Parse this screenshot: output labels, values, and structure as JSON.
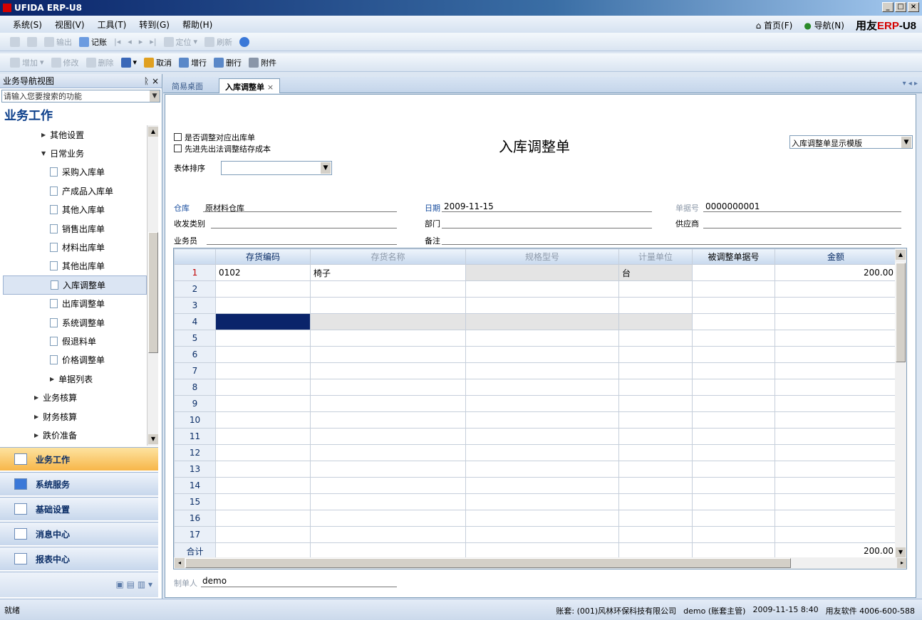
{
  "window": {
    "title": "UFIDA ERP-U8"
  },
  "menu": {
    "items": [
      "系统(S)",
      "视图(V)",
      "工具(T)",
      "转到(G)",
      "帮助(H)"
    ],
    "home": "首页(F)",
    "navigate": "导航(N)",
    "brand_prefix": "用友",
    "brand_erp": "ERP",
    "brand_suffix": "-U8"
  },
  "toolbar1": [
    "输出",
    "记账",
    "定位",
    "刷新"
  ],
  "toolbar2": [
    "增加",
    "修改",
    "删除",
    "取消",
    "增行",
    "删行",
    "附件"
  ],
  "nav": {
    "header": "业务导航视图",
    "search_placeholder": "请输入您要搜索的功能",
    "section_title": "业务工作",
    "tree": [
      {
        "label": "其他设置",
        "level": 2,
        "type": "collapsed"
      },
      {
        "label": "日常业务",
        "level": 2,
        "type": "expanded"
      },
      {
        "label": "采购入库单",
        "level": 3,
        "type": "doc"
      },
      {
        "label": "产成品入库单",
        "level": 3,
        "type": "doc"
      },
      {
        "label": "其他入库单",
        "level": 3,
        "type": "doc"
      },
      {
        "label": "销售出库单",
        "level": 3,
        "type": "doc"
      },
      {
        "label": "材料出库单",
        "level": 3,
        "type": "doc"
      },
      {
        "label": "其他出库单",
        "level": 3,
        "type": "doc"
      },
      {
        "label": "入库调整单",
        "level": 3,
        "type": "doc",
        "selected": true
      },
      {
        "label": "出库调整单",
        "level": 3,
        "type": "doc"
      },
      {
        "label": "系统调整单",
        "level": 3,
        "type": "doc"
      },
      {
        "label": "假退料单",
        "level": 3,
        "type": "doc"
      },
      {
        "label": "价格调整单",
        "level": 3,
        "type": "doc"
      },
      {
        "label": "单据列表",
        "level": 3,
        "type": "collapsed"
      },
      {
        "label": "业务核算",
        "level": 1,
        "type": "collapsed"
      },
      {
        "label": "财务核算",
        "level": 1,
        "type": "collapsed"
      },
      {
        "label": "跌价准备",
        "level": 1,
        "type": "collapsed"
      }
    ],
    "buttons": [
      "业务工作",
      "系统服务",
      "基础设置",
      "消息中心",
      "报表中心"
    ]
  },
  "tabs": {
    "desktop": "简易桌面",
    "current": "入库调整单"
  },
  "form": {
    "title": "入库调整单",
    "check1": "是否调整对应出库单",
    "check2": "先进先出法调整结存成本",
    "sort_label": "表体排序",
    "template": "入库调整单显示模版",
    "warehouse_label": "仓库",
    "warehouse": "原材料仓库",
    "date_label": "日期",
    "date": "2009-11-15",
    "docno_label": "单据号",
    "docno": "0000000001",
    "recv_label": "收发类别",
    "dept_label": "部门",
    "supplier_label": "供应商",
    "staff_label": "业务员",
    "memo_label": "备注",
    "maker_label": "制单人",
    "maker": "demo"
  },
  "grid": {
    "columns": [
      "存货编码",
      "存货名称",
      "规格型号",
      "计量单位",
      "被调整单据号",
      "金额"
    ],
    "rows": [
      {
        "no": "1",
        "code": "0102",
        "name": "椅子",
        "spec": "",
        "unit": "台",
        "ref": "",
        "amount": "200.00"
      },
      {
        "no": "2"
      },
      {
        "no": "3"
      },
      {
        "no": "4"
      },
      {
        "no": "5"
      },
      {
        "no": "6"
      },
      {
        "no": "7"
      },
      {
        "no": "8"
      },
      {
        "no": "9"
      },
      {
        "no": "10"
      },
      {
        "no": "11"
      },
      {
        "no": "12"
      },
      {
        "no": "13"
      },
      {
        "no": "14"
      },
      {
        "no": "15"
      },
      {
        "no": "16"
      },
      {
        "no": "17"
      }
    ],
    "total_label": "合计",
    "total_amount": "200.00"
  },
  "status": {
    "left": "就绪",
    "account": "账套: (001)风林环保科技有限公司",
    "user": "demo (账套主管)",
    "datetime": "2009-11-15 8:40",
    "vendor": "用友软件 4006-600-588"
  }
}
